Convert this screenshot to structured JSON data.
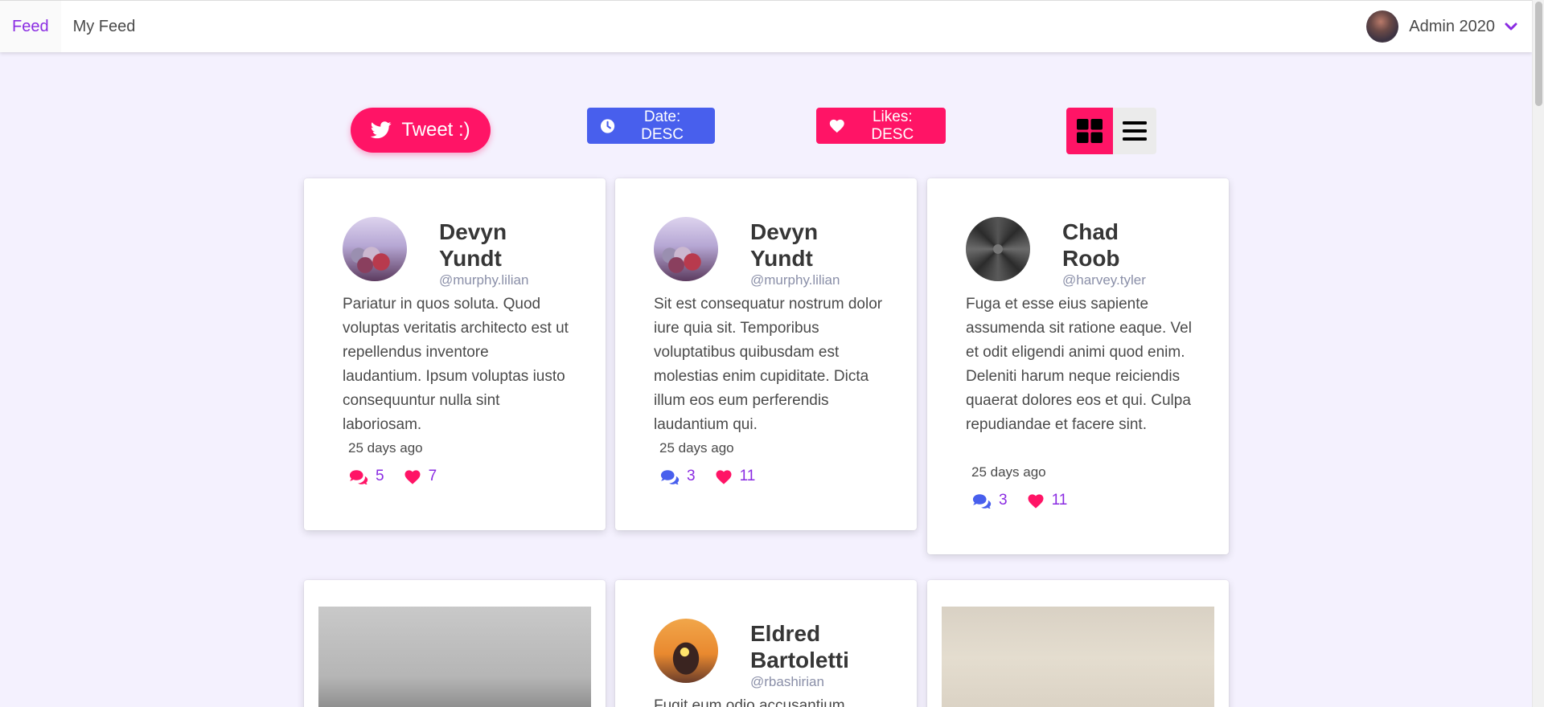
{
  "navbar": {
    "tabs": [
      {
        "label": "Feed",
        "active": true
      },
      {
        "label": "My Feed",
        "active": false
      }
    ],
    "user": {
      "name": "Admin 2020",
      "avatar_icon": "user-avatar"
    }
  },
  "toolbar": {
    "tweet_label": "Tweet :)",
    "sort_date_label": "Date: DESC",
    "sort_likes_label": "Likes: DESC",
    "view_modes": [
      "grid",
      "list"
    ],
    "active_view": "grid"
  },
  "colors": {
    "accent_pink": "#ff1466",
    "accent_blue": "#485fed",
    "accent_purple": "#8a2be2",
    "background": "#f4f1fe"
  },
  "posts": [
    {
      "name_line1": "Devyn",
      "name_line2": "Yundt",
      "handle": "@murphy.lilian",
      "text": "Pariatur in quos soluta. Quod voluptas veritatis architecto est ut repellendus inventore laudantium. Ipsum voluptas iusto consequuntur nulla sint laboriosam.",
      "time": "25 days ago",
      "comments": "5",
      "likes": "7"
    },
    {
      "name_line1": "Devyn",
      "name_line2": "Yundt",
      "handle": "@murphy.lilian",
      "text": "Sit est consequatur nostrum dolor iure quia sit. Temporibus voluptatibus quibusdam est molestias enim cupiditate. Dicta illum eos eum perferendis laudantium qui.",
      "time": "25 days ago",
      "comments": "3",
      "likes": "11"
    },
    {
      "name_line1": "Chad",
      "name_line2": "Roob",
      "handle": "@harvey.tyler",
      "text": "Fuga et esse eius sapiente assumenda sit ratione eaque. Vel et odit eligendi animi quod enim. Deleniti harum neque reiciendis quaerat dolores eos et qui. Culpa repudiandae et facere sint.",
      "time": "25 days ago",
      "comments": "3",
      "likes": "11"
    },
    {
      "name_line1": "Eldred",
      "name_line2": "Bartoletti",
      "handle": "@rbashirian",
      "text": "Fugit eum odio accusantium"
    }
  ]
}
